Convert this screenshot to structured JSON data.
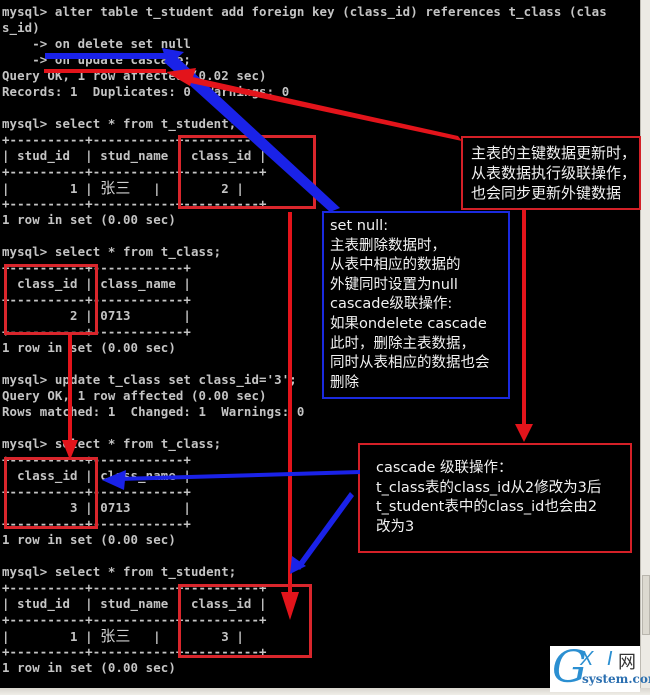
{
  "terminal": {
    "lines": [
      "mysql> alter table t_student add foreign key (class_id) references t_class (clas",
      "s_id)",
      "    -> on delete set null",
      "    -> on update cascade;",
      "Query OK, 1 row affected (0.02 sec)",
      "Records: 1  Duplicates: 0  Warnings: 0",
      "",
      "mysql> select * from t_student;",
      "+----------+-----------+----------+",
      "| stud_id  | stud_name | class_id |",
      "+----------+-----------+----------+",
      "|        1 | ",
      "+----------+-----------+----------+",
      "1 row in set (0.00 sec)",
      "",
      "mysql> select * from t_class;",
      "+----------+------------+",
      "| class_id | class_name |",
      "+----------+------------+",
      "|        2 | 0713       |",
      "+----------+------------+",
      "1 row in set (0.00 sec)",
      "",
      "mysql> update t_class set class_id='3';",
      "Query OK, 1 row affected (0.00 sec)",
      "Rows matched: 1  Changed: 1  Warnings: 0",
      "",
      "mysql> select * from t_class;",
      "+----------+------------+",
      "| class_id | class_name |",
      "+----------+------------+",
      "|        3 | 0713       |",
      "+----------+------------+",
      "1 row in set (0.00 sec)",
      "",
      "mysql> select * from t_student;",
      "+----------+-----------+----------+",
      "| stud_id  | stud_name | class_id |",
      "+----------+-----------+----------+",
      "|        1 | ",
      "+----------+-----------+----------+",
      "1 row in set (0.00 sec)"
    ],
    "student_row_1": {
      "name": "张三",
      "tail": "   |        2 |"
    },
    "student_row_2": {
      "name": "张三",
      "tail": "   |        3 |"
    }
  },
  "annotations": {
    "update_cascade_note": "主表的主键数据更新时，\n从表数据执行级联操作，\n也会同步更新外键数据",
    "set_null_note": "set null:\n主表删除数据时，\n从表中相应的数据的\n外键同时设置为null\ncascade级联操作:\n如果ondelete cascade\n此时，删除主表数据，\n同时从表相应的数据也会\n删除",
    "cascade_example_note": "cascade 级联操作：\nt_class表的class_id从2修改为3后\nt_student表中的class_id也会由2\n改为3"
  },
  "colors": {
    "red": "#e3141b",
    "blue": "#1a22e8",
    "terminal_text": "#c4c4c4"
  },
  "watermark": {
    "g": "G",
    "xi": "X I",
    "wang": "网",
    "domain": "system.com"
  }
}
